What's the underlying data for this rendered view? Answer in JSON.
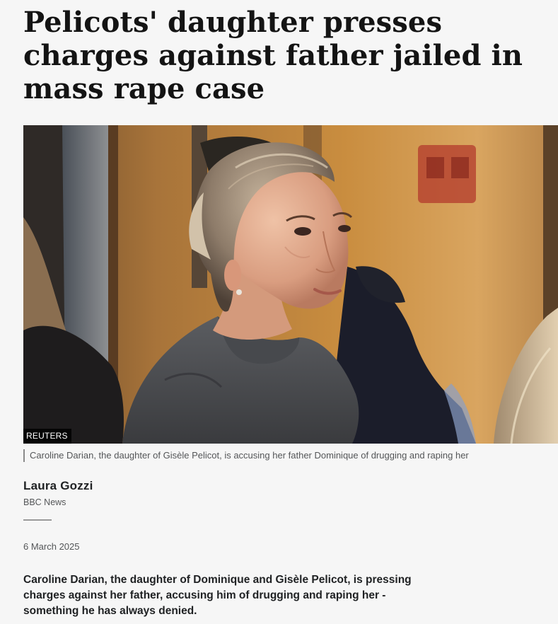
{
  "article": {
    "headline": "Pelicots' daughter presses charges against father jailed in mass rape case",
    "image": {
      "credit": "REUTERS",
      "caption": "Caroline Darian, the daughter of Gisèle Pelicot, is accusing her father Dominique of drugging and raping her"
    },
    "byline": {
      "author": "Laura Gozzi",
      "organization": "BBC News"
    },
    "date": "6 March 2025",
    "lede": "Caroline Darian, the daughter of Dominique and Gisèle Pelicot, is pressing charges against her father, accusing him of drugging and raping her - something he has always denied."
  }
}
